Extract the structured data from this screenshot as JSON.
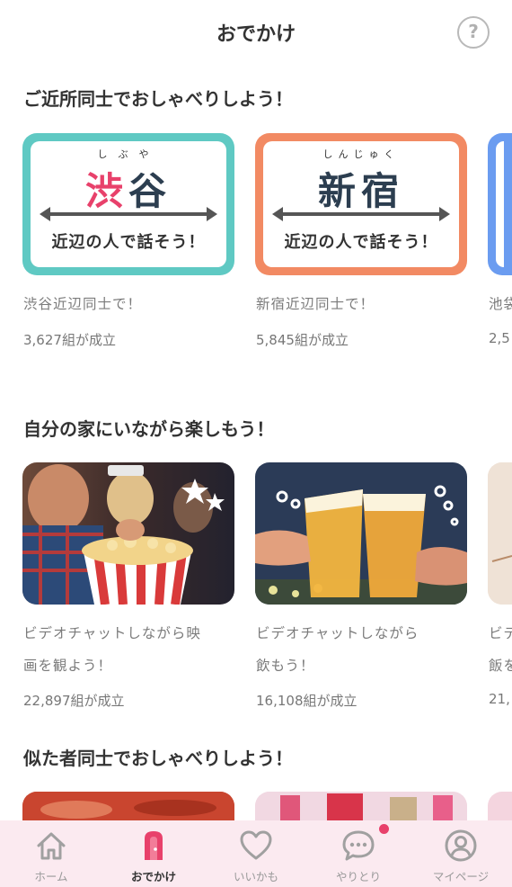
{
  "header": {
    "title": "おでかけ",
    "help_label": "?"
  },
  "sections": [
    {
      "title": "ご近所同士でおしゃべりしよう！"
    },
    {
      "title": "自分の家にいながら楽しもう！"
    },
    {
      "title": "似た者同士でおしゃべりしよう！"
    }
  ],
  "location_cards": [
    {
      "furigana": "しぶや",
      "name": "渋谷",
      "tagline": "近辺の人で話そう！",
      "caption": "渋谷近辺同士で！",
      "count": "3,627組が成立",
      "frame_color": "#5fc9c3"
    },
    {
      "furigana": "しんじゅく",
      "name": "新宿",
      "tagline": "近辺の人で話そう！",
      "caption": "新宿近辺同士で！",
      "count": "5,845組が成立",
      "frame_color": "#f28a63"
    },
    {
      "caption": "池袋",
      "count": "2,5",
      "frame_color": "#6b9cf0"
    }
  ],
  "video_cards": [
    {
      "caption_line1": "ビデオチャットしながら映",
      "caption_line2": "画を観よう！",
      "count": "22,897組が成立",
      "image": "movie-popcorn-photo"
    },
    {
      "caption_line1": "ビデオチャットしながら",
      "caption_line2": "飲もう！",
      "count": "16,108組が成立",
      "image": "beer-toast-photo"
    },
    {
      "caption_line1": "ビデ",
      "caption_line2": "飯を",
      "count": "21,",
      "image": "partial-photo"
    }
  ],
  "tabbar": {
    "accent": "#e8416b",
    "items": [
      {
        "label": "ホーム",
        "icon": "home-icon",
        "active": false
      },
      {
        "label": "おでかけ",
        "icon": "door-icon",
        "active": true
      },
      {
        "label": "いいかも",
        "icon": "heart-icon",
        "active": false
      },
      {
        "label": "やりとり",
        "icon": "chat-bubble-icon",
        "active": false,
        "badge": true
      },
      {
        "label": "マイページ",
        "icon": "user-icon",
        "active": false
      }
    ]
  }
}
